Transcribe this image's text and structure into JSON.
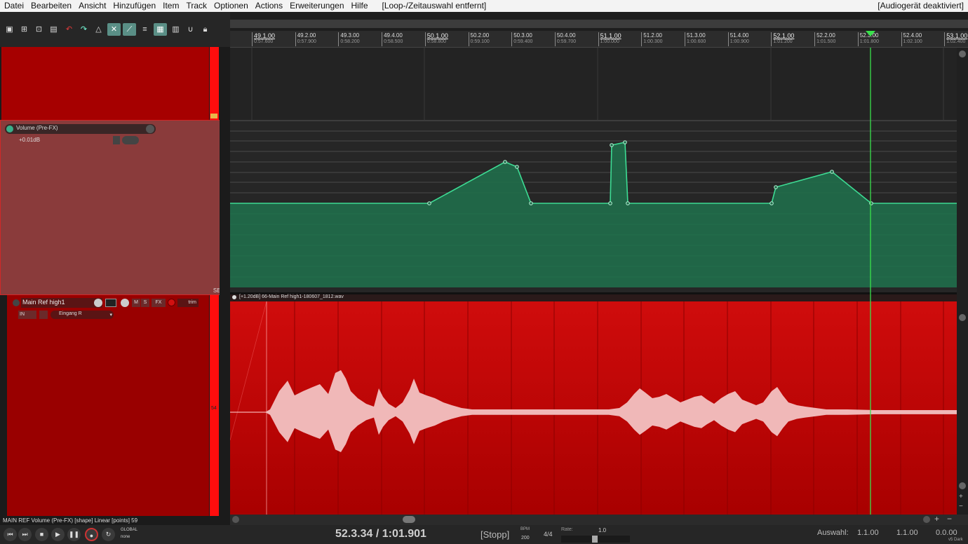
{
  "menu": {
    "items": [
      "Datei",
      "Bearbeiten",
      "Ansicht",
      "Hinzufügen",
      "Item",
      "Track",
      "Optionen",
      "Actions",
      "Erweiterungen",
      "Hilfe"
    ],
    "status": "[Loop-/Zeitauswahl entfernt]",
    "audio_status": "[Audiogerät deaktiviert]"
  },
  "ruler": {
    "ticks": [
      {
        "bar": "49.1.00",
        "time": "0:57.600",
        "major": true
      },
      {
        "bar": "49.2.00",
        "time": "0:57.900",
        "major": false
      },
      {
        "bar": "49.3.00",
        "time": "0:58.200",
        "major": false
      },
      {
        "bar": "49.4.00",
        "time": "0:58.500",
        "major": false
      },
      {
        "bar": "50.1.00",
        "time": "0:58.800",
        "major": true
      },
      {
        "bar": "50.2.00",
        "time": "0:59.100",
        "major": false
      },
      {
        "bar": "50.3.00",
        "time": "0:59.400",
        "major": false
      },
      {
        "bar": "50.4.00",
        "time": "0:59.700",
        "major": false
      },
      {
        "bar": "51.1.00",
        "time": "1:00.000",
        "major": true
      },
      {
        "bar": "51.2.00",
        "time": "1:00.300",
        "major": false
      },
      {
        "bar": "51.3.00",
        "time": "1:00.600",
        "major": false
      },
      {
        "bar": "51.4.00",
        "time": "1:00.900",
        "major": false
      },
      {
        "bar": "52.1.00",
        "time": "1:01.200",
        "major": true
      },
      {
        "bar": "52.2.00",
        "time": "1:01.500",
        "major": false
      },
      {
        "bar": "52.3.00",
        "time": "1:01.800",
        "major": false
      },
      {
        "bar": "52.4.00",
        "time": "1:02.100",
        "major": false
      },
      {
        "bar": "53.1.00",
        "time": "1:02.400",
        "major": true
      }
    ]
  },
  "envelope_lane": {
    "name": "Volume (Pre-FX)",
    "value": "+0.01dB",
    "sel": "SEL"
  },
  "track": {
    "name": "Main Ref high1",
    "input_label": "IN",
    "input": "Eingang R",
    "item_label": "[+1.20dB] 66-Main Ref high1-180607_1812.wav",
    "meter_value": "54",
    "btn_m": "M",
    "btn_s": "S",
    "btn_fx": "FX",
    "btn_trim": "trim"
  },
  "status_line": "MAIN REF Volume (Pre-FX) [shape] Linear [points] 59",
  "transport": {
    "position": "52.3.34 / 1:01.901",
    "state": "[Stopp]",
    "bpm_label": "BPM",
    "bpm": "200",
    "time_sig": "4/4",
    "rate_label": "Rate:",
    "rate": "1.0",
    "global_label": "GLOBAL",
    "global_mode": "none",
    "selection_label": "Auswahl:",
    "sel_start": "1.1.00",
    "sel_end": "1.1.00",
    "sel_length": "0.0.00",
    "theme": "v5 Dark"
  },
  "colors": {
    "track_red": "#b30000",
    "envelope_green": "#2ea36f",
    "playhead": "#39e14b",
    "meter_red": "#ff0d0d"
  }
}
